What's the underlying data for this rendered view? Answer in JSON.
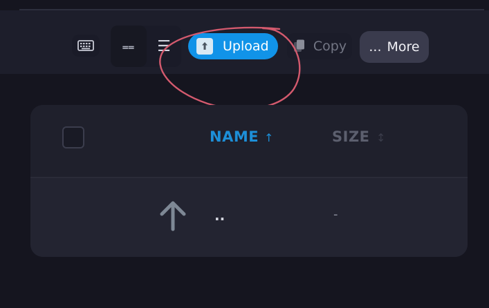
{
  "toolbar": {
    "keyboard_icon": "keyboard-icon",
    "grid_view_icon": "grid-view-icon",
    "grid_view_glyph": "⩵",
    "list_view_icon": "list-view-icon",
    "list_view_glyph": "☰",
    "upload": {
      "label": "Upload",
      "icon": "upload-icon",
      "color": "#1193e8"
    },
    "copy": {
      "label": "Copy",
      "icon": "copy-icon"
    },
    "more": {
      "label": "More",
      "ellipsis": "..."
    }
  },
  "annotation": {
    "shape": "hand-drawn circle around upload button",
    "color": "#d45a6e"
  },
  "file_table": {
    "columns": [
      {
        "label": "NAME",
        "sort_icon": "↑",
        "active": true
      },
      {
        "label": "SIZE",
        "sort_icon": "↕",
        "active": false
      }
    ],
    "rows": [
      {
        "icon": "arrow-up-icon",
        "name": "..",
        "size": "-"
      }
    ]
  },
  "colors": {
    "background": "#15151f",
    "toolbar": "#1d1e2b",
    "accent": "#1193e8",
    "panel": "#20212d"
  }
}
